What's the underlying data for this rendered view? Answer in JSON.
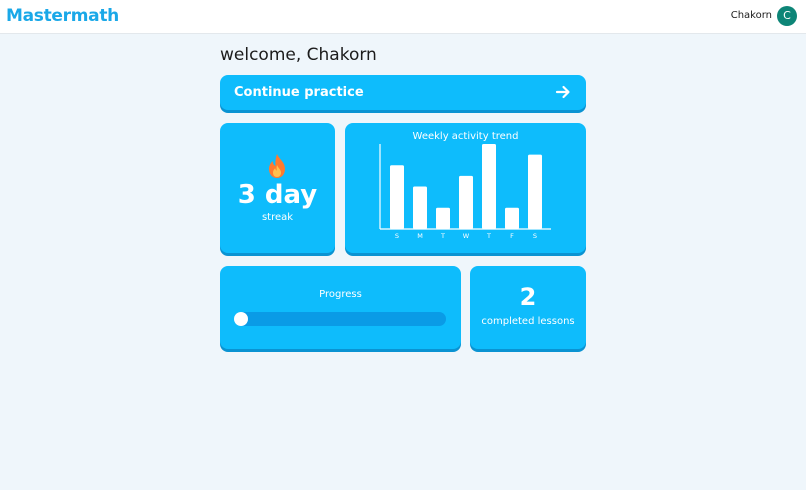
{
  "header": {
    "logo": "Mastermath",
    "user_name": "Chakorn",
    "avatar_initial": "C"
  },
  "welcome": "welcome, Chakorn",
  "continue": {
    "label": "Continue practice",
    "icon": "arrow-right-icon"
  },
  "streak": {
    "icon": "fire-icon",
    "value": "3 day",
    "label": "streak"
  },
  "activity": {
    "title": "Weekly activity trend"
  },
  "chart_data": {
    "type": "bar",
    "title": "Weekly activity trend",
    "categories": [
      "S",
      "M",
      "T",
      "W",
      "T",
      "F",
      "S"
    ],
    "values": [
      6,
      4,
      2,
      5,
      8,
      2,
      7
    ],
    "ylim": [
      0,
      8
    ],
    "grid": false,
    "bar_color": "#ffffff"
  },
  "progress": {
    "title": "Progress",
    "value": 0
  },
  "lessons": {
    "count": "2",
    "label": "completed lessons"
  },
  "colors": {
    "accent": "#0ebcfc",
    "accent_dark": "#0a93d2",
    "brand": "#1aa8e8",
    "avatar": "#0d8577",
    "background": "#eff6fb"
  }
}
